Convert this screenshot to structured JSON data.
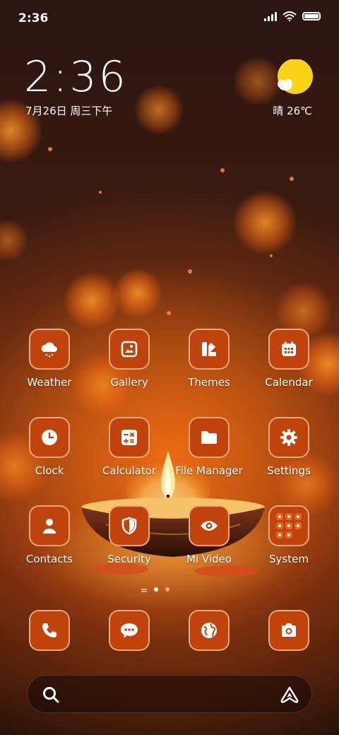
{
  "status_bar": {
    "time": "2:36",
    "signal_icon": "signal-bars-icon",
    "wifi_icon": "wifi-icon",
    "battery_icon": "battery-icon"
  },
  "clock_widget": {
    "time": "2:36",
    "date": "7月26日 周三下午",
    "weather_icon": "sun-cloud-icon",
    "weather": "晴 26℃"
  },
  "apps": [
    {
      "label": "Weather",
      "icon": "weather-icon"
    },
    {
      "label": "Gallery",
      "icon": "gallery-icon"
    },
    {
      "label": "Themes",
      "icon": "themes-icon"
    },
    {
      "label": "Calendar",
      "icon": "calendar-icon"
    },
    {
      "label": "Clock",
      "icon": "clock-icon"
    },
    {
      "label": "Calculator",
      "icon": "calculator-icon"
    },
    {
      "label": "File Manager",
      "icon": "folder-icon"
    },
    {
      "label": "Settings",
      "icon": "gear-icon"
    },
    {
      "label": "Contacts",
      "icon": "contacts-icon"
    },
    {
      "label": "Security",
      "icon": "shield-icon"
    },
    {
      "label": "Mi Video",
      "icon": "eye-icon"
    },
    {
      "label": "System",
      "icon": "folder-grid-icon"
    }
  ],
  "page_indicator": {
    "pages": 2,
    "active_page": 1
  },
  "dock": [
    {
      "icon": "phone-icon"
    },
    {
      "icon": "messages-icon"
    },
    {
      "icon": "browser-globe-icon"
    },
    {
      "icon": "camera-icon"
    }
  ],
  "search_bar": {
    "search_icon": "search-icon",
    "assistant_icon": "assistant-icon"
  },
  "colors": {
    "icon_bg": "#c0430c",
    "icon_border": "#ffd2b4",
    "sun": "#ffd21a"
  }
}
